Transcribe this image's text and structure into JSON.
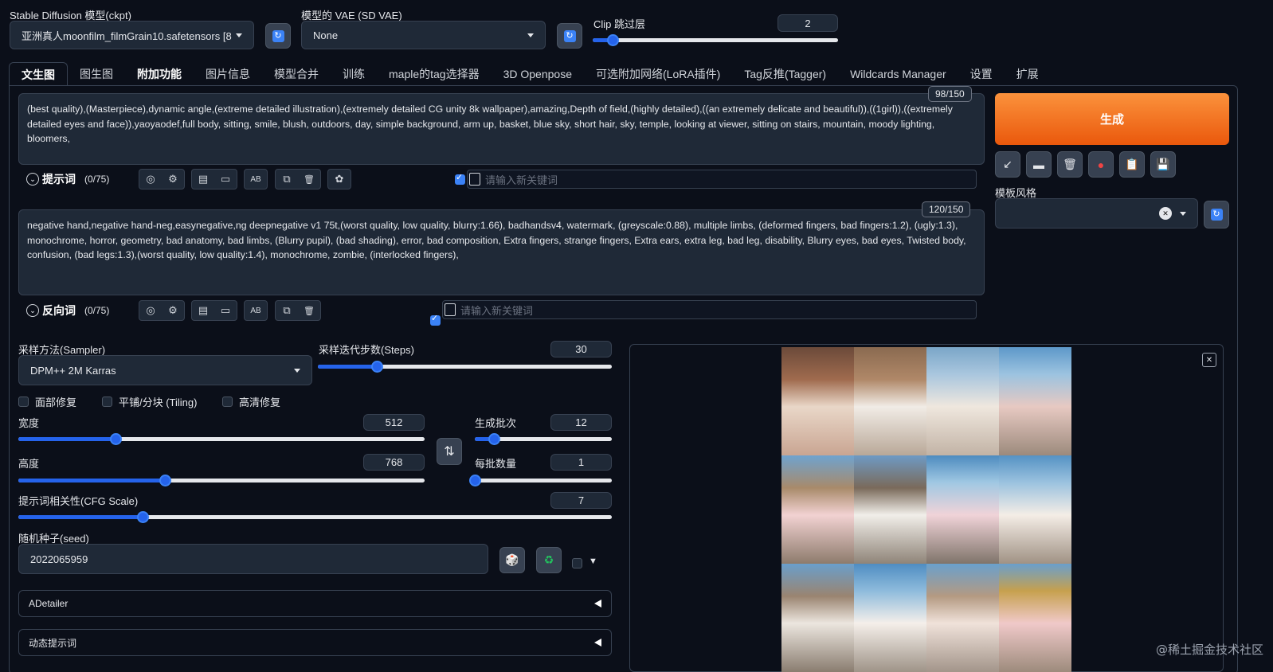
{
  "top": {
    "model_label": "Stable Diffusion 模型(ckpt)",
    "model_value": "亚洲真人moonfilm_filmGrain10.safetensors [8",
    "vae_label": "模型的 VAE (SD VAE)",
    "vae_value": "None",
    "clip_label": "Clip 跳过层",
    "clip_value": "2",
    "clip_level": 0.08,
    "refresh_glyph": "↻"
  },
  "tabs": [
    {
      "label": "文生图"
    },
    {
      "label": "图生图"
    },
    {
      "label": "附加功能"
    },
    {
      "label": "图片信息"
    },
    {
      "label": "模型合并"
    },
    {
      "label": "训练"
    },
    {
      "label": "maple的tag选择器"
    },
    {
      "label": "3D Openpose"
    },
    {
      "label": "可选附加网络(LoRA插件)"
    },
    {
      "label": "Tag反推(Tagger)"
    },
    {
      "label": "Wildcards Manager"
    },
    {
      "label": "设置"
    },
    {
      "label": "扩展"
    }
  ],
  "prompt": {
    "counter": "98/150",
    "text": "(best quality),(Masterpiece),dynamic angle,(extreme detailed illustration),(extremely detailed CG unity 8k wallpaper),amazing,Depth of field,(highly detailed),((an extremely delicate and beautiful)),((1girl)),((extremely detailed eyes and face)),yaoyaodef,full body, sitting, smile, blush, outdoors, day, simple background, arm up, basket, blue sky, short hair, sky, temple, looking at viewer, sitting on stairs, mountain, moody lighting, bloomers,",
    "section_title": "提示词",
    "token_count": "(0/75)",
    "keyword_placeholder": "请输入新关键词"
  },
  "negative": {
    "counter": "120/150",
    "text": "negative hand,negative hand-neg,easynegative,ng deepnegative v1 75t,(worst quality, low quality, blurry:1.66), badhandsv4, watermark, (greyscale:0.88), multiple limbs, (deformed fingers, bad fingers:1.2), (ugly:1.3), monochrome, horror, geometry, bad anatomy, bad limbs, (Blurry pupil), (bad shading), error, bad composition, Extra fingers, strange fingers, Extra ears, extra leg, bad leg, disability, Blurry eyes, bad eyes, Twisted body, confusion, (bad legs:1.3),(worst quality, low quality:1.4), monochrome, zombie, (interlocked fingers),",
    "section_title": "反向词",
    "token_count": "(0/75)",
    "keyword_placeholder": "请输入新关键词"
  },
  "toolbar_glyphs": {
    "globe": "◎",
    "gear": "⚙",
    "clipboard": "▤",
    "bookmark": "▭",
    "ab": "AB",
    "copy": "⧉",
    "trash": "🗑",
    "openai": "✿"
  },
  "right": {
    "generate_label": "生成",
    "style_label": "模板风格",
    "style_clear": "✕",
    "action_glyphs": [
      "↙",
      "▬",
      "🗑",
      "●",
      "📋",
      "💾"
    ]
  },
  "params": {
    "sampler_label": "采样方法(Sampler)",
    "sampler_value": "DPM++ 2M Karras",
    "steps_label": "采样迭代步数(Steps)",
    "steps_value": "30",
    "steps_level": 0.2,
    "face_restore": "面部修复",
    "tiling": "平铺/分块 (Tiling)",
    "hires": "高清修复",
    "width_label": "宽度",
    "width_value": "512",
    "width_level": 0.24,
    "height_label": "高度",
    "height_value": "768",
    "height_level": 0.36,
    "swap_glyph": "⇅",
    "batch_count_label": "生成批次",
    "batch_count_value": "12",
    "batch_count_level": 0.14,
    "batch_size_label": "每批数量",
    "batch_size_value": "1",
    "batch_size_level": 0.0,
    "cfg_label": "提示词相关性(CFG Scale)",
    "cfg_value": "7",
    "cfg_level": 0.21,
    "seed_label": "随机种子(seed)",
    "seed_value": "2022065959",
    "dice_glyph": "🎲",
    "recycle_glyph": "♻",
    "extra_toggle": "▼"
  },
  "accordions": {
    "adetailer": "ADetailer",
    "dynamic_prompts": "动态提示词"
  },
  "gallery": {
    "close_glyph": "✕"
  },
  "watermark": "@稀土掘金技术社区",
  "colors": {
    "background": "#0b0f19",
    "accent": "#2563eb",
    "generate": "#ea580c"
  }
}
